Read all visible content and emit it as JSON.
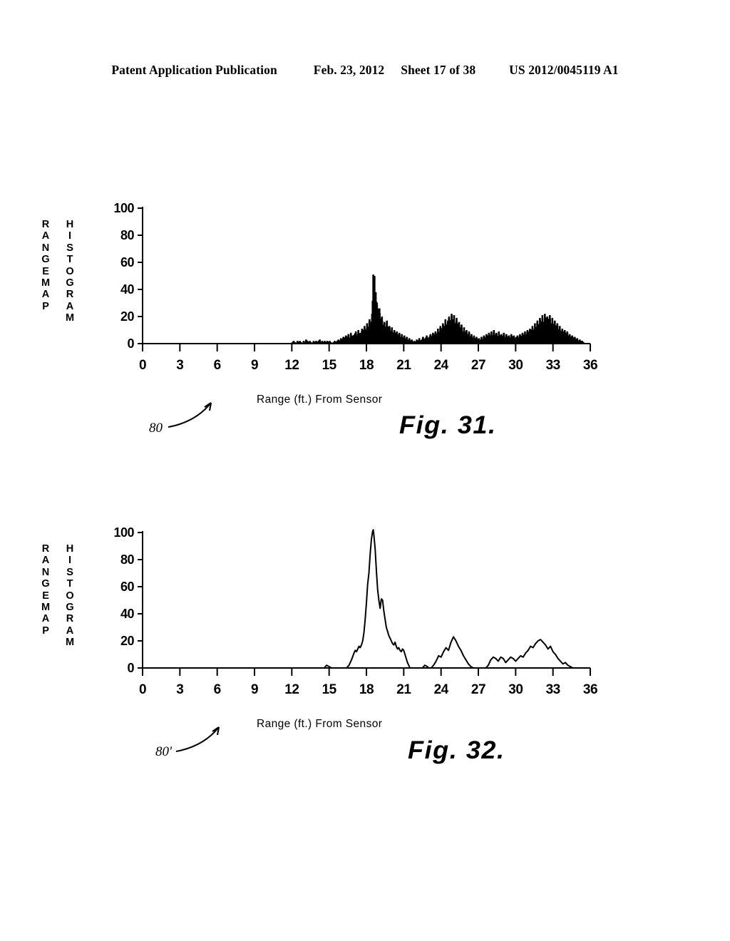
{
  "header": {
    "publication": "Patent Application Publication",
    "date": "Feb. 23, 2012",
    "sheet": "Sheet 17 of 38",
    "docnum": "US 2012/0045119 A1"
  },
  "figures": [
    {
      "id": "fig31",
      "caption": "Fig. 31.",
      "reference_numeral": "80",
      "ylabel_left": "R\nA\nN\nG\nE\nM\nA\nP",
      "ylabel_right": "H\nI\nS\nT\nO\nG\nR\nA\nM",
      "xlabel": "Range (ft.) From Sensor"
    },
    {
      "id": "fig32",
      "caption": "Fig. 32.",
      "reference_numeral": "80'",
      "ylabel_left": "R\nA\nN\nG\nE\nM\nA\nP",
      "ylabel_right": "H\nI\nS\nT\nO\nG\nR\nA\nM",
      "xlabel": "Range (ft.) From Sensor"
    }
  ],
  "chart_data": [
    {
      "type": "bar",
      "id": "fig31",
      "title": "Fig. 31.",
      "xlabel": "Range (ft.) From Sensor",
      "ylabel": "RANGE MAP HISTOGRAM",
      "xlim": [
        0,
        36
      ],
      "ylim": [
        0,
        100
      ],
      "xticks": [
        0,
        3,
        6,
        9,
        12,
        15,
        18,
        21,
        24,
        27,
        30,
        33,
        36
      ],
      "yticks": [
        0,
        20,
        40,
        60,
        80,
        100
      ],
      "grid": false,
      "legend": false,
      "bar_color": "#000000",
      "note": "Raw (unsmoothed) range-map histogram; dense narrow bins at 0.05 ft spacing",
      "x": [
        12.05,
        12.15,
        12.25,
        12.35,
        12.45,
        12.55,
        12.65,
        12.75,
        12.85,
        12.95,
        13.05,
        13.15,
        13.25,
        13.35,
        13.45,
        13.55,
        13.65,
        13.75,
        13.85,
        13.95,
        14.05,
        14.15,
        14.25,
        14.35,
        14.45,
        14.55,
        14.65,
        14.75,
        14.85,
        14.95,
        15.05,
        15.15,
        15.25,
        15.35,
        15.45,
        15.55,
        15.65,
        15.75,
        15.85,
        15.95,
        16.05,
        16.15,
        16.25,
        16.35,
        16.45,
        16.55,
        16.65,
        16.75,
        16.85,
        16.95,
        17.05,
        17.15,
        17.25,
        17.35,
        17.45,
        17.55,
        17.65,
        17.75,
        17.85,
        17.95,
        18.05,
        18.15,
        18.25,
        18.35,
        18.45,
        18.55,
        18.65,
        18.75,
        18.85,
        18.95,
        19.05,
        19.15,
        19.25,
        19.35,
        19.45,
        19.55,
        19.65,
        19.75,
        19.85,
        19.95,
        20.05,
        20.15,
        20.25,
        20.35,
        20.45,
        20.55,
        20.65,
        20.75,
        20.85,
        20.95,
        21.05,
        21.15,
        21.25,
        21.35,
        21.45,
        21.55,
        21.65,
        21.75,
        21.85,
        21.95,
        22.05,
        22.15,
        22.25,
        22.35,
        22.45,
        22.55,
        22.65,
        22.75,
        22.85,
        22.95,
        23.05,
        23.15,
        23.25,
        23.35,
        23.45,
        23.55,
        23.65,
        23.75,
        23.85,
        23.95,
        24.05,
        24.15,
        24.25,
        24.35,
        24.45,
        24.55,
        24.65,
        24.75,
        24.85,
        24.95,
        25.05,
        25.15,
        25.25,
        25.35,
        25.45,
        25.55,
        25.65,
        25.75,
        25.85,
        25.95,
        26.05,
        26.15,
        26.25,
        26.35,
        26.45,
        26.55,
        26.65,
        26.75,
        26.85,
        26.95,
        27.05,
        27.15,
        27.25,
        27.35,
        27.45,
        27.55,
        27.65,
        27.75,
        27.85,
        27.95,
        28.05,
        28.15,
        28.25,
        28.35,
        28.45,
        28.55,
        28.65,
        28.75,
        28.85,
        28.95,
        29.05,
        29.15,
        29.25,
        29.35,
        29.45,
        29.55,
        29.65,
        29.75,
        29.85,
        29.95,
        30.05,
        30.15,
        30.25,
        30.35,
        30.45,
        30.55,
        30.65,
        30.75,
        30.85,
        30.95,
        31.05,
        31.15,
        31.25,
        31.35,
        31.45,
        31.55,
        31.65,
        31.75,
        31.85,
        31.95,
        32.05,
        32.15,
        32.25,
        32.35,
        32.45,
        32.55,
        32.65,
        32.75,
        32.85,
        32.95,
        33.05,
        33.15,
        33.25,
        33.35,
        33.45,
        33.55,
        33.65,
        33.75,
        33.85,
        33.95,
        34.05,
        34.15,
        34.25,
        34.35,
        34.45,
        34.55,
        34.65,
        34.75,
        34.85,
        34.95,
        35.05,
        35.15,
        35.25,
        35.35,
        35.45
      ],
      "y": [
        1,
        2,
        1,
        0,
        2,
        1,
        2,
        1,
        0,
        2,
        1,
        3,
        2,
        1,
        2,
        1,
        0,
        2,
        1,
        2,
        1,
        2,
        3,
        1,
        2,
        1,
        2,
        1,
        2,
        1,
        2,
        1,
        0,
        1,
        2,
        1,
        2,
        3,
        2,
        4,
        3,
        5,
        4,
        6,
        5,
        7,
        4,
        8,
        5,
        6,
        7,
        9,
        6,
        10,
        7,
        8,
        11,
        9,
        13,
        10,
        15,
        12,
        18,
        14,
        22,
        51,
        50,
        38,
        30,
        24,
        26,
        18,
        20,
        14,
        16,
        12,
        17,
        11,
        13,
        9,
        12,
        8,
        10,
        7,
        9,
        6,
        8,
        5,
        7,
        4,
        6,
        3,
        5,
        2,
        4,
        2,
        3,
        1,
        2,
        1,
        3,
        2,
        4,
        2,
        3,
        5,
        3,
        4,
        6,
        4,
        5,
        7,
        5,
        8,
        6,
        9,
        7,
        11,
        8,
        13,
        10,
        15,
        12,
        18,
        14,
        17,
        20,
        16,
        22,
        18,
        21,
        15,
        19,
        13,
        16,
        11,
        14,
        9,
        12,
        8,
        10,
        6,
        9,
        5,
        7,
        4,
        6,
        3,
        5,
        3,
        4,
        2,
        5,
        3,
        6,
        4,
        7,
        5,
        8,
        6,
        9,
        5,
        10,
        6,
        8,
        5,
        9,
        6,
        7,
        5,
        8,
        4,
        7,
        5,
        6,
        4,
        7,
        5,
        6,
        4,
        5,
        6,
        4,
        7,
        5,
        8,
        6,
        9,
        7,
        10,
        8,
        11,
        9,
        13,
        10,
        15,
        12,
        17,
        13,
        19,
        15,
        21,
        16,
        22,
        18,
        20,
        17,
        21,
        15,
        19,
        14,
        17,
        12,
        15,
        10,
        13,
        9,
        11,
        8,
        10,
        7,
        9,
        6,
        7,
        5,
        6,
        4,
        5,
        3,
        4,
        2,
        3,
        2,
        2,
        1
      ]
    },
    {
      "type": "line",
      "id": "fig32",
      "title": "Fig. 32.",
      "xlabel": "Range (ft.) From Sensor",
      "ylabel": "RANGE MAP HISTOGRAM",
      "xlim": [
        0,
        36
      ],
      "ylim": [
        0,
        100
      ],
      "xticks": [
        0,
        3,
        6,
        9,
        12,
        15,
        18,
        21,
        24,
        27,
        30,
        33,
        36
      ],
      "yticks": [
        0,
        20,
        40,
        60,
        80,
        100
      ],
      "grid": false,
      "legend": false,
      "line_color": "#000000",
      "note": "Smoothed/filtered range-map histogram of the same scene as Fig. 31",
      "x": [
        0.0,
        14.6,
        14.8,
        15.0,
        15.2,
        15.4,
        16.4,
        16.6,
        16.8,
        17.0,
        17.1,
        17.2,
        17.3,
        17.4,
        17.5,
        17.6,
        17.7,
        17.8,
        17.9,
        18.0,
        18.1,
        18.2,
        18.3,
        18.4,
        18.5,
        18.55,
        18.6,
        18.7,
        18.8,
        18.9,
        19.0,
        19.1,
        19.2,
        19.3,
        19.4,
        19.5,
        19.6,
        19.7,
        19.8,
        19.9,
        20.0,
        20.1,
        20.2,
        20.3,
        20.4,
        20.5,
        20.6,
        20.7,
        20.8,
        20.9,
        21.0,
        21.1,
        21.2,
        21.3,
        21.4,
        21.5,
        22.5,
        22.7,
        22.9,
        23.0,
        23.2,
        23.4,
        23.6,
        23.8,
        24.0,
        24.2,
        24.4,
        24.6,
        24.8,
        25.0,
        25.2,
        25.4,
        25.6,
        25.8,
        26.0,
        26.2,
        26.4,
        26.6,
        27.6,
        27.8,
        28.0,
        28.2,
        28.4,
        28.6,
        28.8,
        29.0,
        29.2,
        29.4,
        29.6,
        29.8,
        30.0,
        30.2,
        30.4,
        30.6,
        30.8,
        31.0,
        31.2,
        31.4,
        31.6,
        31.8,
        32.0,
        32.2,
        32.4,
        32.6,
        32.8,
        33.0,
        33.2,
        33.4,
        33.6,
        33.8,
        34.0,
        34.2,
        34.4,
        34.6,
        36.0
      ],
      "y": [
        0,
        0,
        2,
        1,
        0,
        0,
        0,
        2,
        6,
        11,
        13,
        12,
        14,
        16,
        15,
        17,
        20,
        26,
        36,
        48,
        62,
        70,
        84,
        95,
        101,
        102,
        98,
        88,
        72,
        58,
        50,
        44,
        51,
        50,
        42,
        36,
        30,
        27,
        24,
        22,
        20,
        18,
        17,
        19,
        16,
        14,
        15,
        13,
        12,
        14,
        13,
        10,
        7,
        4,
        2,
        0,
        0,
        2,
        1,
        0,
        0,
        2,
        5,
        9,
        8,
        12,
        15,
        13,
        19,
        23,
        20,
        16,
        13,
        9,
        6,
        3,
        1,
        0,
        0,
        2,
        6,
        8,
        7,
        5,
        8,
        7,
        4,
        6,
        8,
        7,
        5,
        7,
        9,
        8,
        11,
        13,
        16,
        15,
        18,
        20,
        21,
        19,
        17,
        14,
        16,
        12,
        10,
        7,
        5,
        3,
        4,
        2,
        1,
        0,
        0
      ]
    }
  ]
}
